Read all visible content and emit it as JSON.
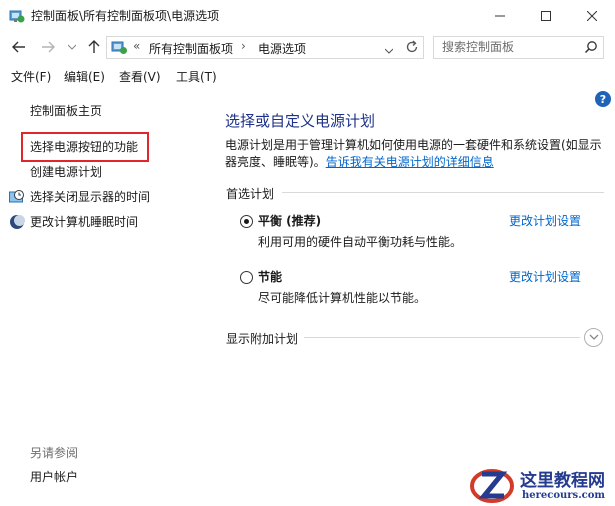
{
  "window": {
    "title": "控制面板\\所有控制面板项\\电源选项"
  },
  "address": {
    "prefix": "«",
    "crumbs": [
      "所有控制面板项",
      "电源选项"
    ],
    "separator": "›"
  },
  "search": {
    "placeholder": "搜索控制面板"
  },
  "menu": [
    "文件(F)",
    "编辑(E)",
    "查看(V)",
    "工具(T)"
  ],
  "sidebar": {
    "home": "控制面板主页",
    "links": [
      "选择电源按钮的功能",
      "创建电源计划",
      "选择关闭显示器的时间",
      "更改计算机睡眠时间"
    ],
    "see_also_title": "另请参阅",
    "see_also_links": [
      "用户帐户"
    ]
  },
  "main": {
    "title": "选择或自定义电源计划",
    "desc_text": "电源计划是用于管理计算机如何使用电源的一套硬件和系统设置(如显示器亮度、睡眠等)。",
    "desc_link": "告诉我有关电源计划的详细信息",
    "preferred_label": "首选计划",
    "plans": [
      {
        "name": "平衡 (推荐)",
        "desc": "利用可用的硬件自动平衡功耗与性能。",
        "link": "更改计划设置",
        "selected": true
      },
      {
        "name": "节能",
        "desc": "尽可能降低计算机性能以节能。",
        "link": "更改计划设置",
        "selected": false
      }
    ],
    "extra_label": "显示附加计划"
  },
  "watermark": {
    "name": "这里教程网",
    "site": "herecours.com"
  },
  "colors": {
    "highlight": "#e0252b",
    "link": "#0066cc",
    "title": "#1e3287"
  }
}
